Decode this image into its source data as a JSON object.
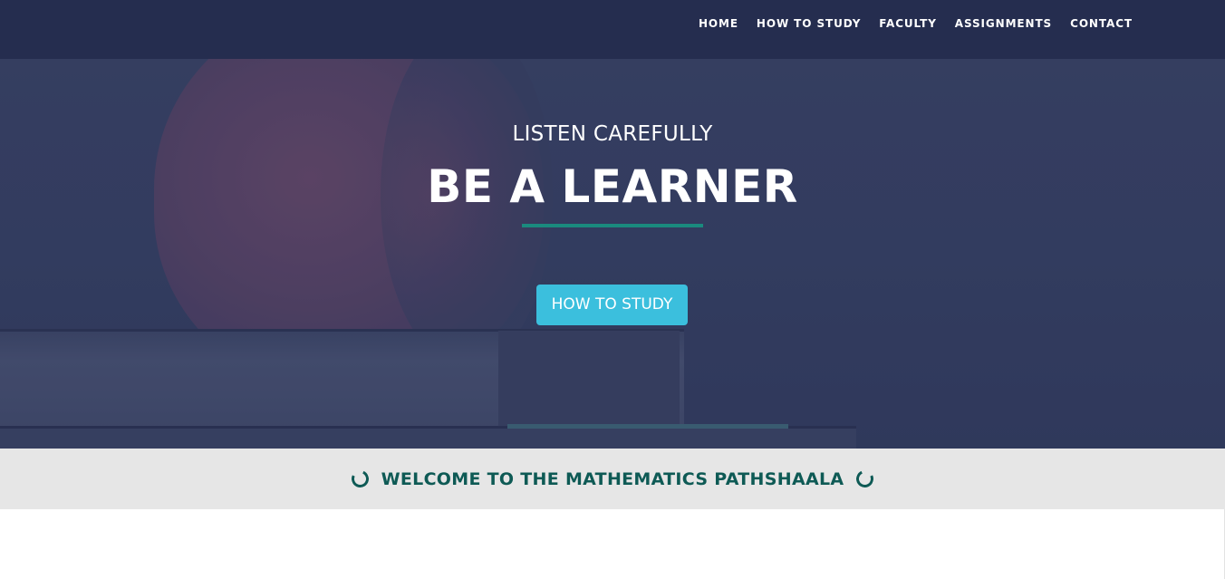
{
  "nav": {
    "items": [
      {
        "label": "HOME"
      },
      {
        "label": "HOW TO STUDY"
      },
      {
        "label": "FACULTY"
      },
      {
        "label": "ASSIGNMENTS"
      },
      {
        "label": "CONTACT"
      }
    ]
  },
  "hero": {
    "subtitle": "LISTEN CAREFULLY",
    "title": "BE A LEARNER",
    "button_label": "HOW TO STUDY",
    "accent_color": "#1a8a7e",
    "button_color": "#3bbfdd"
  },
  "welcome": {
    "text": "WELCOME TO THE MATHEMATICS PATHSHAALA",
    "icon": "loading-ring-icon",
    "text_color": "#0e5a55"
  }
}
